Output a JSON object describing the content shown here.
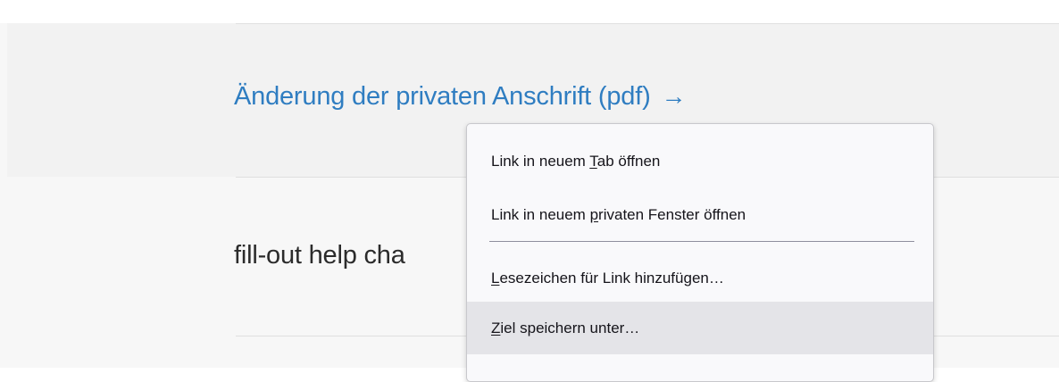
{
  "document_link": {
    "label": "Änderung der privaten Anschrift (pdf)",
    "arrow": "→"
  },
  "section": {
    "heading_visible_text": "fill-out help cha"
  },
  "context_menu": {
    "items": [
      {
        "before": "Link in neuem ",
        "accesskey": "T",
        "after": "ab öffnen",
        "active": false
      },
      {
        "before": "Link in neuem ",
        "accesskey": "p",
        "after": "rivaten Fenster öffnen",
        "active": false
      },
      {
        "before": "",
        "accesskey": "L",
        "after": "esezeichen für Link hinzufügen…",
        "active": false
      },
      {
        "before": "",
        "accesskey": "Z",
        "after": "iel speichern unter…",
        "active": true
      }
    ]
  },
  "colors": {
    "link": "#2f7dc1",
    "band_background": "#f2f2f2",
    "menu_background": "#f9f9fb",
    "menu_hover": "#e4e4e8"
  }
}
